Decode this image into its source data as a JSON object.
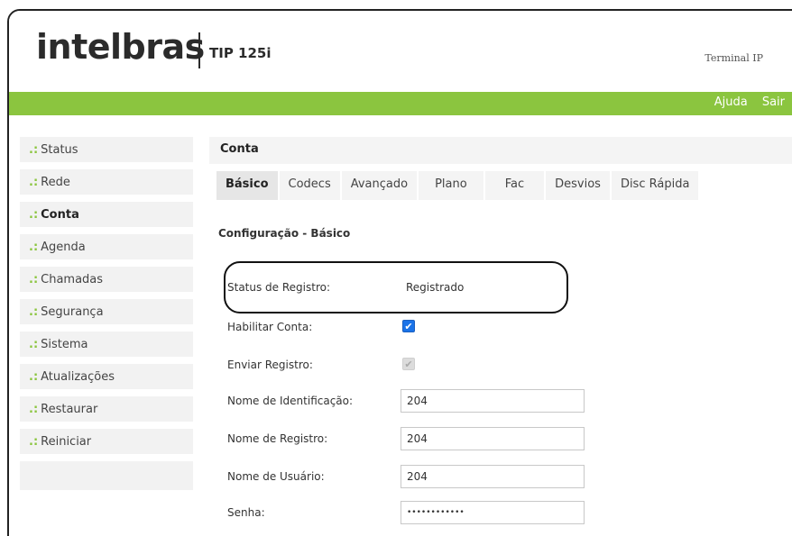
{
  "header": {
    "logo": "intelbras",
    "model": "TIP 125i",
    "terminal_label": "Terminal IP"
  },
  "topbar": {
    "help_label": "Ajuda",
    "exit_label": "Sair"
  },
  "sidebar": {
    "bullet": ".:",
    "items": [
      {
        "label": "Status"
      },
      {
        "label": "Rede"
      },
      {
        "label": "Conta"
      },
      {
        "label": "Agenda"
      },
      {
        "label": "Chamadas"
      },
      {
        "label": "Segurança"
      },
      {
        "label": "Sistema"
      },
      {
        "label": "Atualizações"
      },
      {
        "label": "Restaurar"
      },
      {
        "label": "Reiniciar"
      }
    ],
    "active_item": "Conta"
  },
  "main": {
    "section_title": "Conta",
    "tabs": [
      {
        "label": "Básico"
      },
      {
        "label": "Codecs"
      },
      {
        "label": "Avançado"
      },
      {
        "label": "Plano"
      },
      {
        "label": "Fac"
      },
      {
        "label": "Desvios"
      },
      {
        "label": "Disc Rápida"
      }
    ],
    "active_tab": "Básico",
    "form_title": "Configuração - Básico",
    "fields": {
      "registration_status": {
        "label": "Status de Registro:",
        "value": "Registrado"
      },
      "enable_account": {
        "label": "Habilitar Conta:",
        "checked": true
      },
      "send_registration": {
        "label": "Enviar Registro:",
        "checked": true,
        "disabled": true
      },
      "identification_name": {
        "label": "Nome de Identificação:",
        "value": "204"
      },
      "registration_name": {
        "label": "Nome de Registro:",
        "value": "204"
      },
      "user_name": {
        "label": "Nome de Usuário:",
        "value": "204"
      },
      "password": {
        "label": "Senha:",
        "value": "••••••••••••"
      }
    }
  },
  "colors": {
    "brand_green": "#8bc53f",
    "checkbox_blue": "#1a73e8"
  }
}
